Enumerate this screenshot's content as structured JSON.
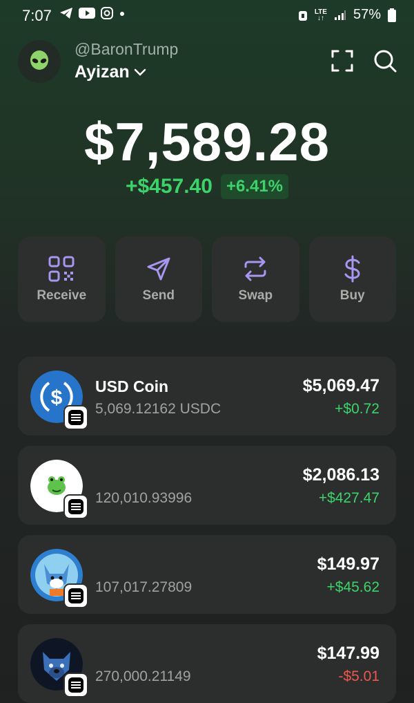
{
  "status_bar": {
    "time": "7:07",
    "signal_label": "LTE",
    "battery": "57%"
  },
  "account": {
    "handle": "@BaronTrump",
    "name": "Ayizan"
  },
  "balance": {
    "total": "$7,589.28",
    "change_amount": "+$457.40",
    "change_percent": "+6.41%"
  },
  "actions": [
    {
      "label": "Receive",
      "icon": "qr-code-icon"
    },
    {
      "label": "Send",
      "icon": "send-icon"
    },
    {
      "label": "Swap",
      "icon": "swap-icon"
    },
    {
      "label": "Buy",
      "icon": "dollar-icon"
    }
  ],
  "tokens": [
    {
      "name": "USD Coin",
      "amount": "5,069.12162 USDC",
      "value": "$5,069.47",
      "change": "+$0.72",
      "icon": "usdc-icon"
    },
    {
      "name": "",
      "amount": "120,010.93996",
      "value": "$2,086.13",
      "change": "+$427.47",
      "icon": "frog-token-icon"
    },
    {
      "name": "",
      "amount": "107,017.27809",
      "value": "$149.97",
      "change": "+$45.62",
      "icon": "fox-token-icon"
    },
    {
      "name": "",
      "amount": "270,000.21149",
      "value": "$147.99",
      "change": "-$5.01",
      "icon": "dog-token-icon"
    }
  ],
  "colors": {
    "positive": "#3cd46a",
    "negative": "#f0564f",
    "accent": "#a996f0"
  }
}
